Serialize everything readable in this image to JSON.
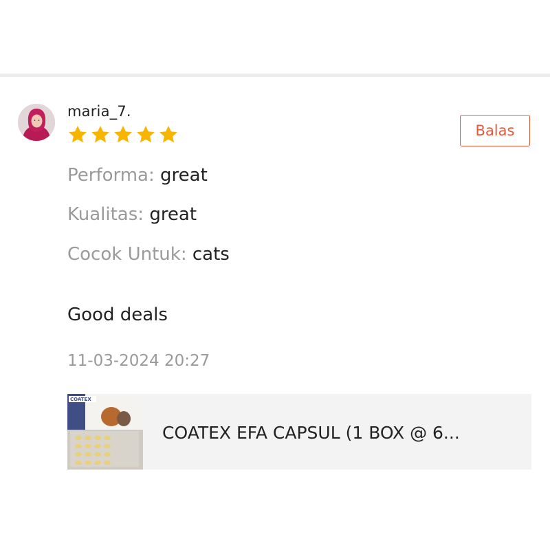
{
  "review": {
    "username": "maria_7.",
    "rating": 5,
    "rating_max": 5,
    "reply_label": "Balas",
    "attributes": [
      {
        "key": "Performa: ",
        "value": "great"
      },
      {
        "key": "Kualitas: ",
        "value": "great"
      },
      {
        "key": "Cocok Untuk: ",
        "value": "cats"
      }
    ],
    "comment": "Good deals",
    "timestamp": "11-03-2024 20:27"
  },
  "product": {
    "title": "COATEX EFA CAPSUL (1 BOX @ 6...",
    "thumbnail_brand": "COATEX"
  },
  "colors": {
    "accent": "#e05a3a",
    "star": "#f7b500",
    "muted_text": "#9a9a9a",
    "divider": "#ececec",
    "card_bg": "#f3f3f3"
  }
}
